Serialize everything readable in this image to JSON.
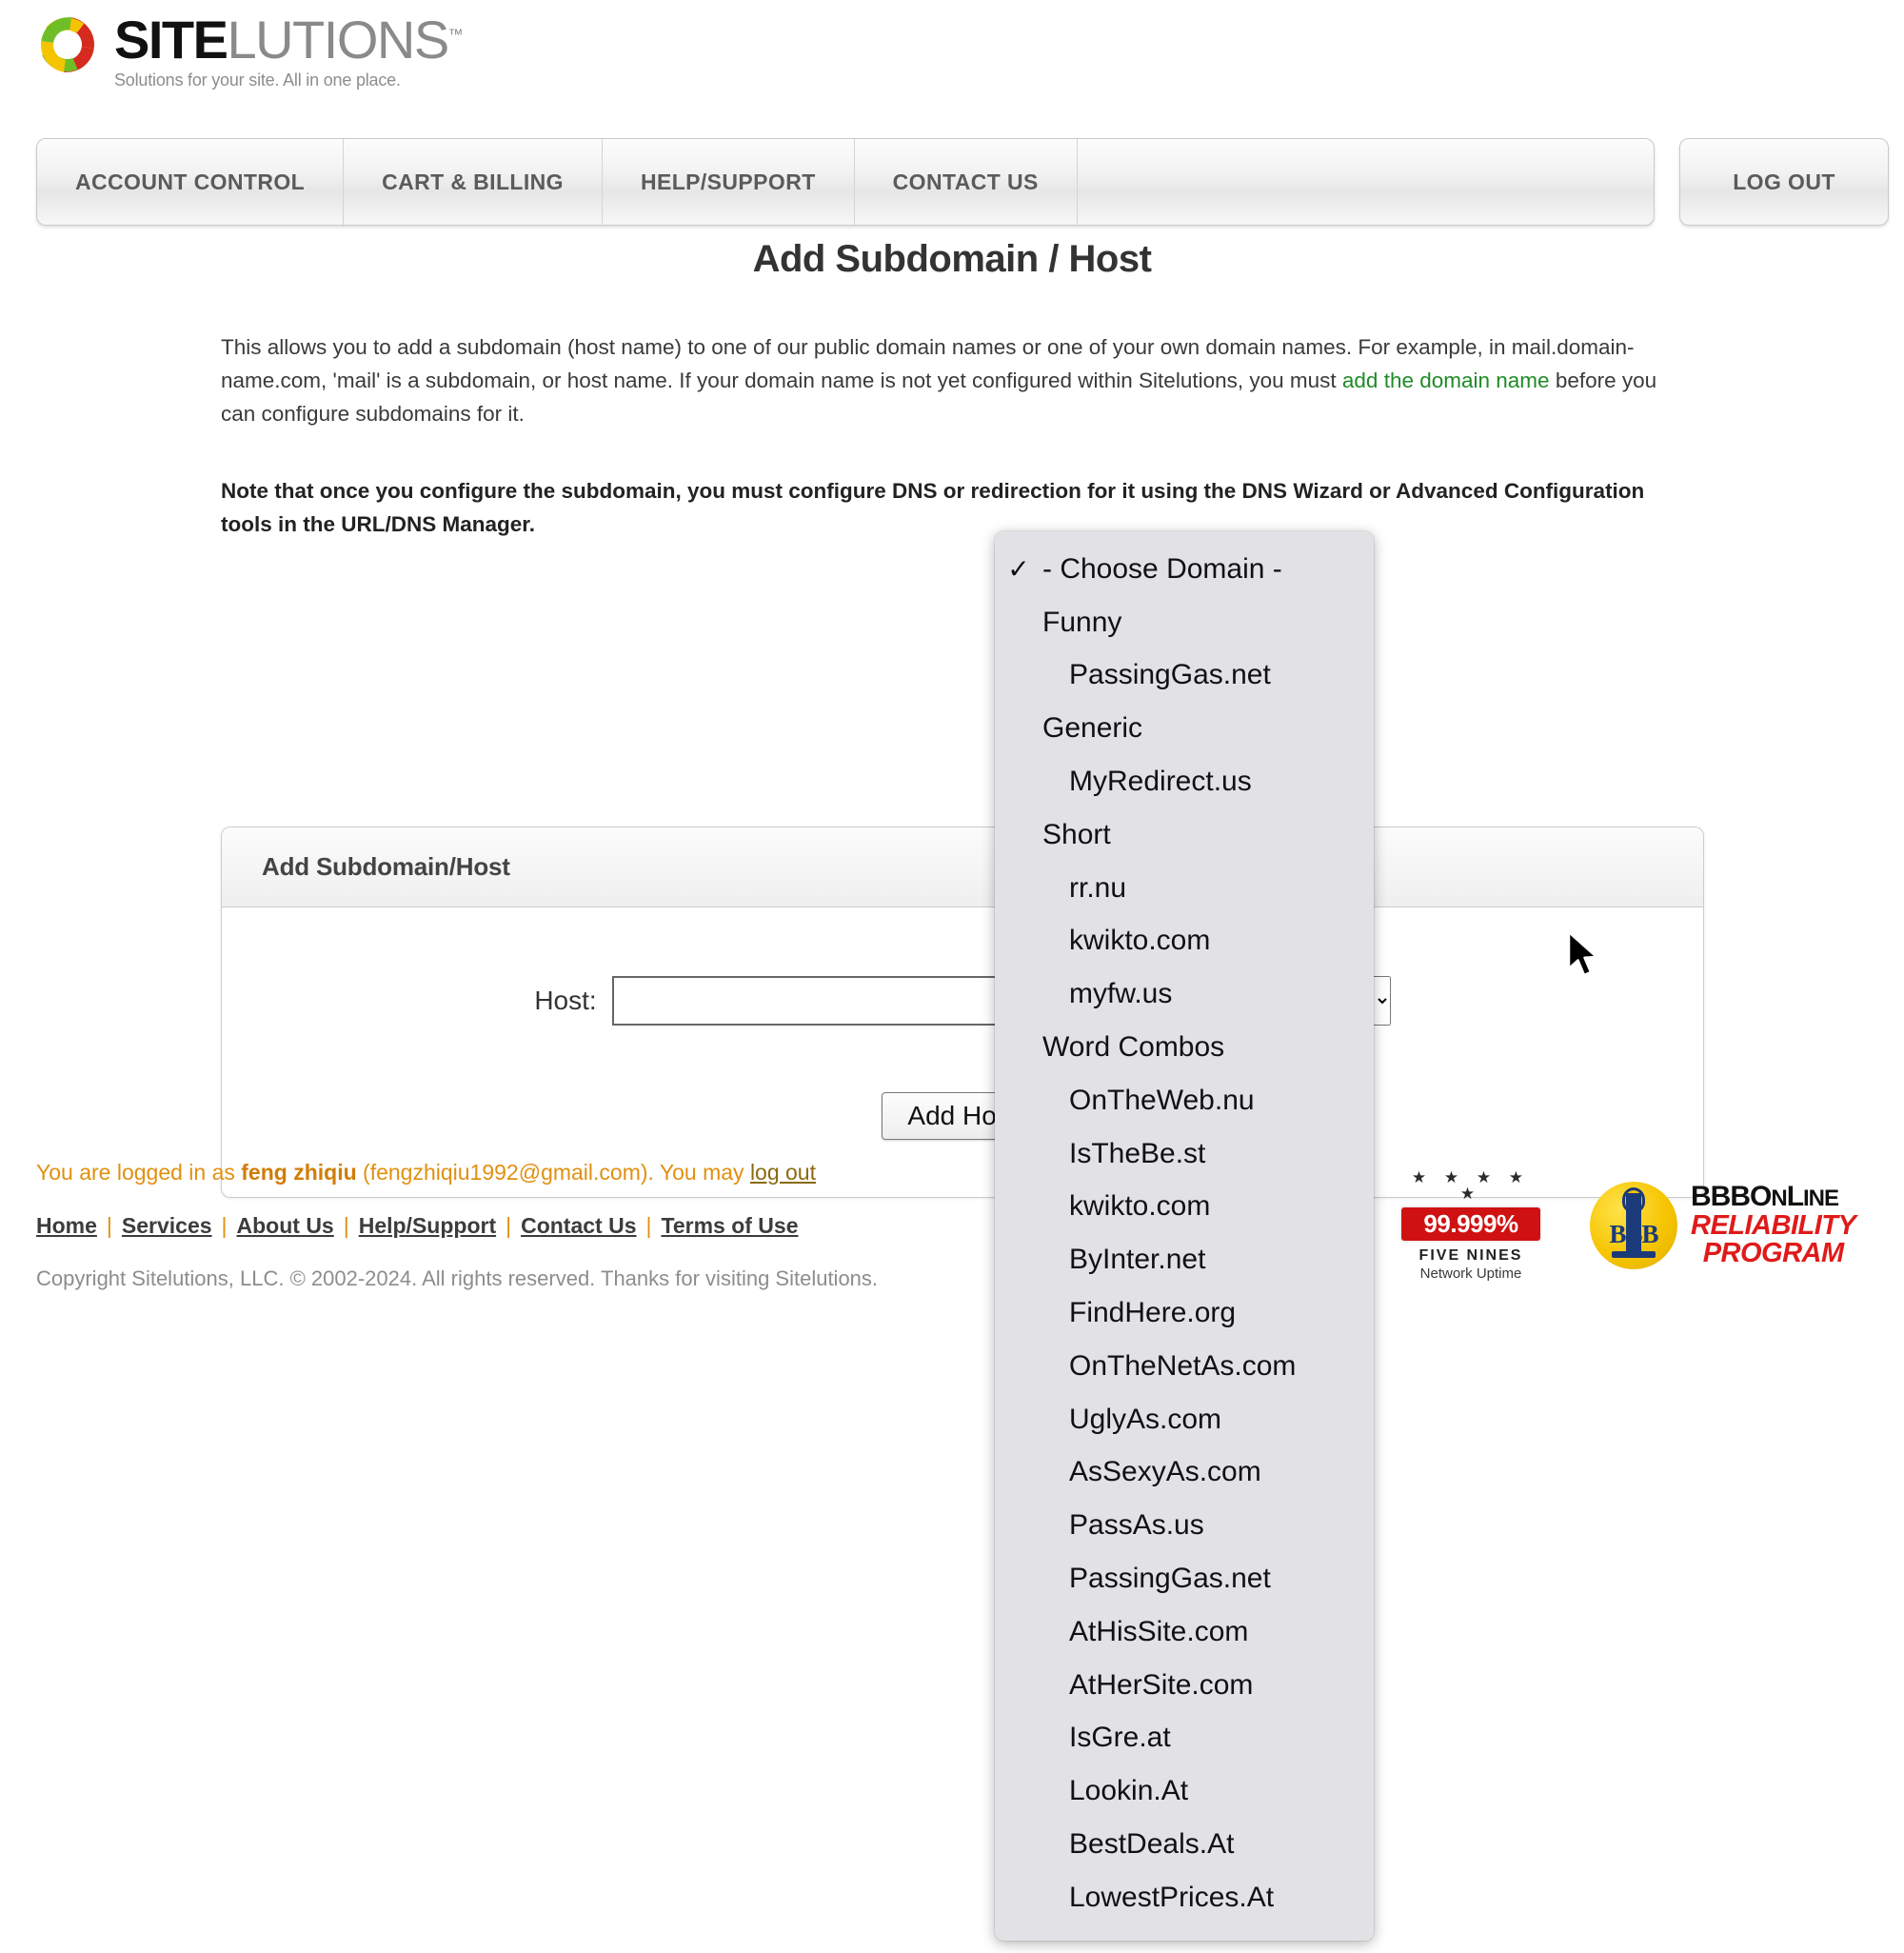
{
  "brand": {
    "name_bold": "SITE",
    "name_light": "LUTIONS",
    "tm": "™",
    "tagline": "Solutions for your site. All in one place."
  },
  "nav": {
    "items": [
      {
        "label": "ACCOUNT CONTROL"
      },
      {
        "label": "CART & BILLING"
      },
      {
        "label": "HELP/SUPPORT"
      },
      {
        "label": "CONTACT US"
      }
    ],
    "logout_label": "LOG OUT"
  },
  "page": {
    "title": "Add Subdomain / Host",
    "intro_part1": "This allows you to add a subdomain (host name) to one of our public domain names or one of your own domain names. For example, in mail.domain-name.com, 'mail' is a subdomain, or host name. If your domain name is not yet configured within Sitelutions, you must ",
    "intro_link": "add the domain name",
    "intro_part2": " before you can configure subdomains for it.",
    "note": "Note that once you configure the subdomain, you must configure DNS or redirection for it using the DNS Wizard or Advanced Configuration tools in the URL/DNS Manager."
  },
  "form": {
    "panel_title": "Add Subdomain/Host",
    "host_label": "Host:",
    "host_value": "",
    "host_placeholder": "",
    "add_button_label": "Add Host"
  },
  "dropdown": {
    "selected_label": "- Choose Domain -",
    "check_glyph": "✓",
    "entries": [
      {
        "type": "selected",
        "label": "- Choose Domain -"
      },
      {
        "type": "group",
        "label": "Funny"
      },
      {
        "type": "option",
        "label": "PassingGas.net"
      },
      {
        "type": "group",
        "label": "Generic"
      },
      {
        "type": "option",
        "label": "MyRedirect.us"
      },
      {
        "type": "group",
        "label": "Short"
      },
      {
        "type": "option",
        "label": "rr.nu"
      },
      {
        "type": "option",
        "label": "kwikto.com"
      },
      {
        "type": "option",
        "label": "myfw.us"
      },
      {
        "type": "group",
        "label": "Word Combos"
      },
      {
        "type": "option",
        "label": "OnTheWeb.nu"
      },
      {
        "type": "option",
        "label": "IsTheBe.st"
      },
      {
        "type": "option",
        "label": "kwikto.com"
      },
      {
        "type": "option",
        "label": "ByInter.net"
      },
      {
        "type": "option",
        "label": "FindHere.org"
      },
      {
        "type": "option",
        "label": "OnTheNetAs.com"
      },
      {
        "type": "option",
        "label": "UglyAs.com"
      },
      {
        "type": "option",
        "label": "AsSexyAs.com"
      },
      {
        "type": "option",
        "label": "PassAs.us"
      },
      {
        "type": "option",
        "label": "PassingGas.net"
      },
      {
        "type": "option",
        "label": "AtHisSite.com"
      },
      {
        "type": "option",
        "label": "AtHerSite.com"
      },
      {
        "type": "option",
        "label": "IsGre.at"
      },
      {
        "type": "option",
        "label": "Lookin.At"
      },
      {
        "type": "option",
        "label": "BestDeals.At"
      },
      {
        "type": "option",
        "label": "LowestPrices.At"
      }
    ]
  },
  "footer": {
    "login_prefix": "You are logged in as ",
    "login_user": "feng zhiqiu",
    "login_email": " (fengzhiqiu1992@gmail.com). You may ",
    "logout_link": "log out",
    "links": [
      {
        "label": "Home"
      },
      {
        "label": "Services"
      },
      {
        "label": "About Us"
      },
      {
        "label": "Help/Support"
      },
      {
        "label": "Contact Us"
      },
      {
        "label": "Terms of Use"
      }
    ],
    "link_separator": "|",
    "copyright": "Copyright Sitelutions, LLC. © 2002-2024. All rights reserved.  Thanks for visiting Sitelutions.",
    "uptime_badge": {
      "stars": "★ ★ ★ ★ ★",
      "percent": "99.999%",
      "line1": "FIVE NINES",
      "line2": "Network Uptime"
    },
    "bbb_badge": {
      "seal_letters": "BBB",
      "line1_a": "BBB",
      "line1_b": "O",
      "line1_c": "N",
      "line1_d": "L",
      "line1_e": "INE",
      "line2": "RELIABILITY",
      "line3": "PROGRAM"
    }
  },
  "colors": {
    "accent_orange": "#e09010",
    "link_green": "#1f8b27",
    "badge_red": "#d01111",
    "bbb_blue": "#1b3a7a",
    "bbb_yellow": "#f5c400"
  }
}
